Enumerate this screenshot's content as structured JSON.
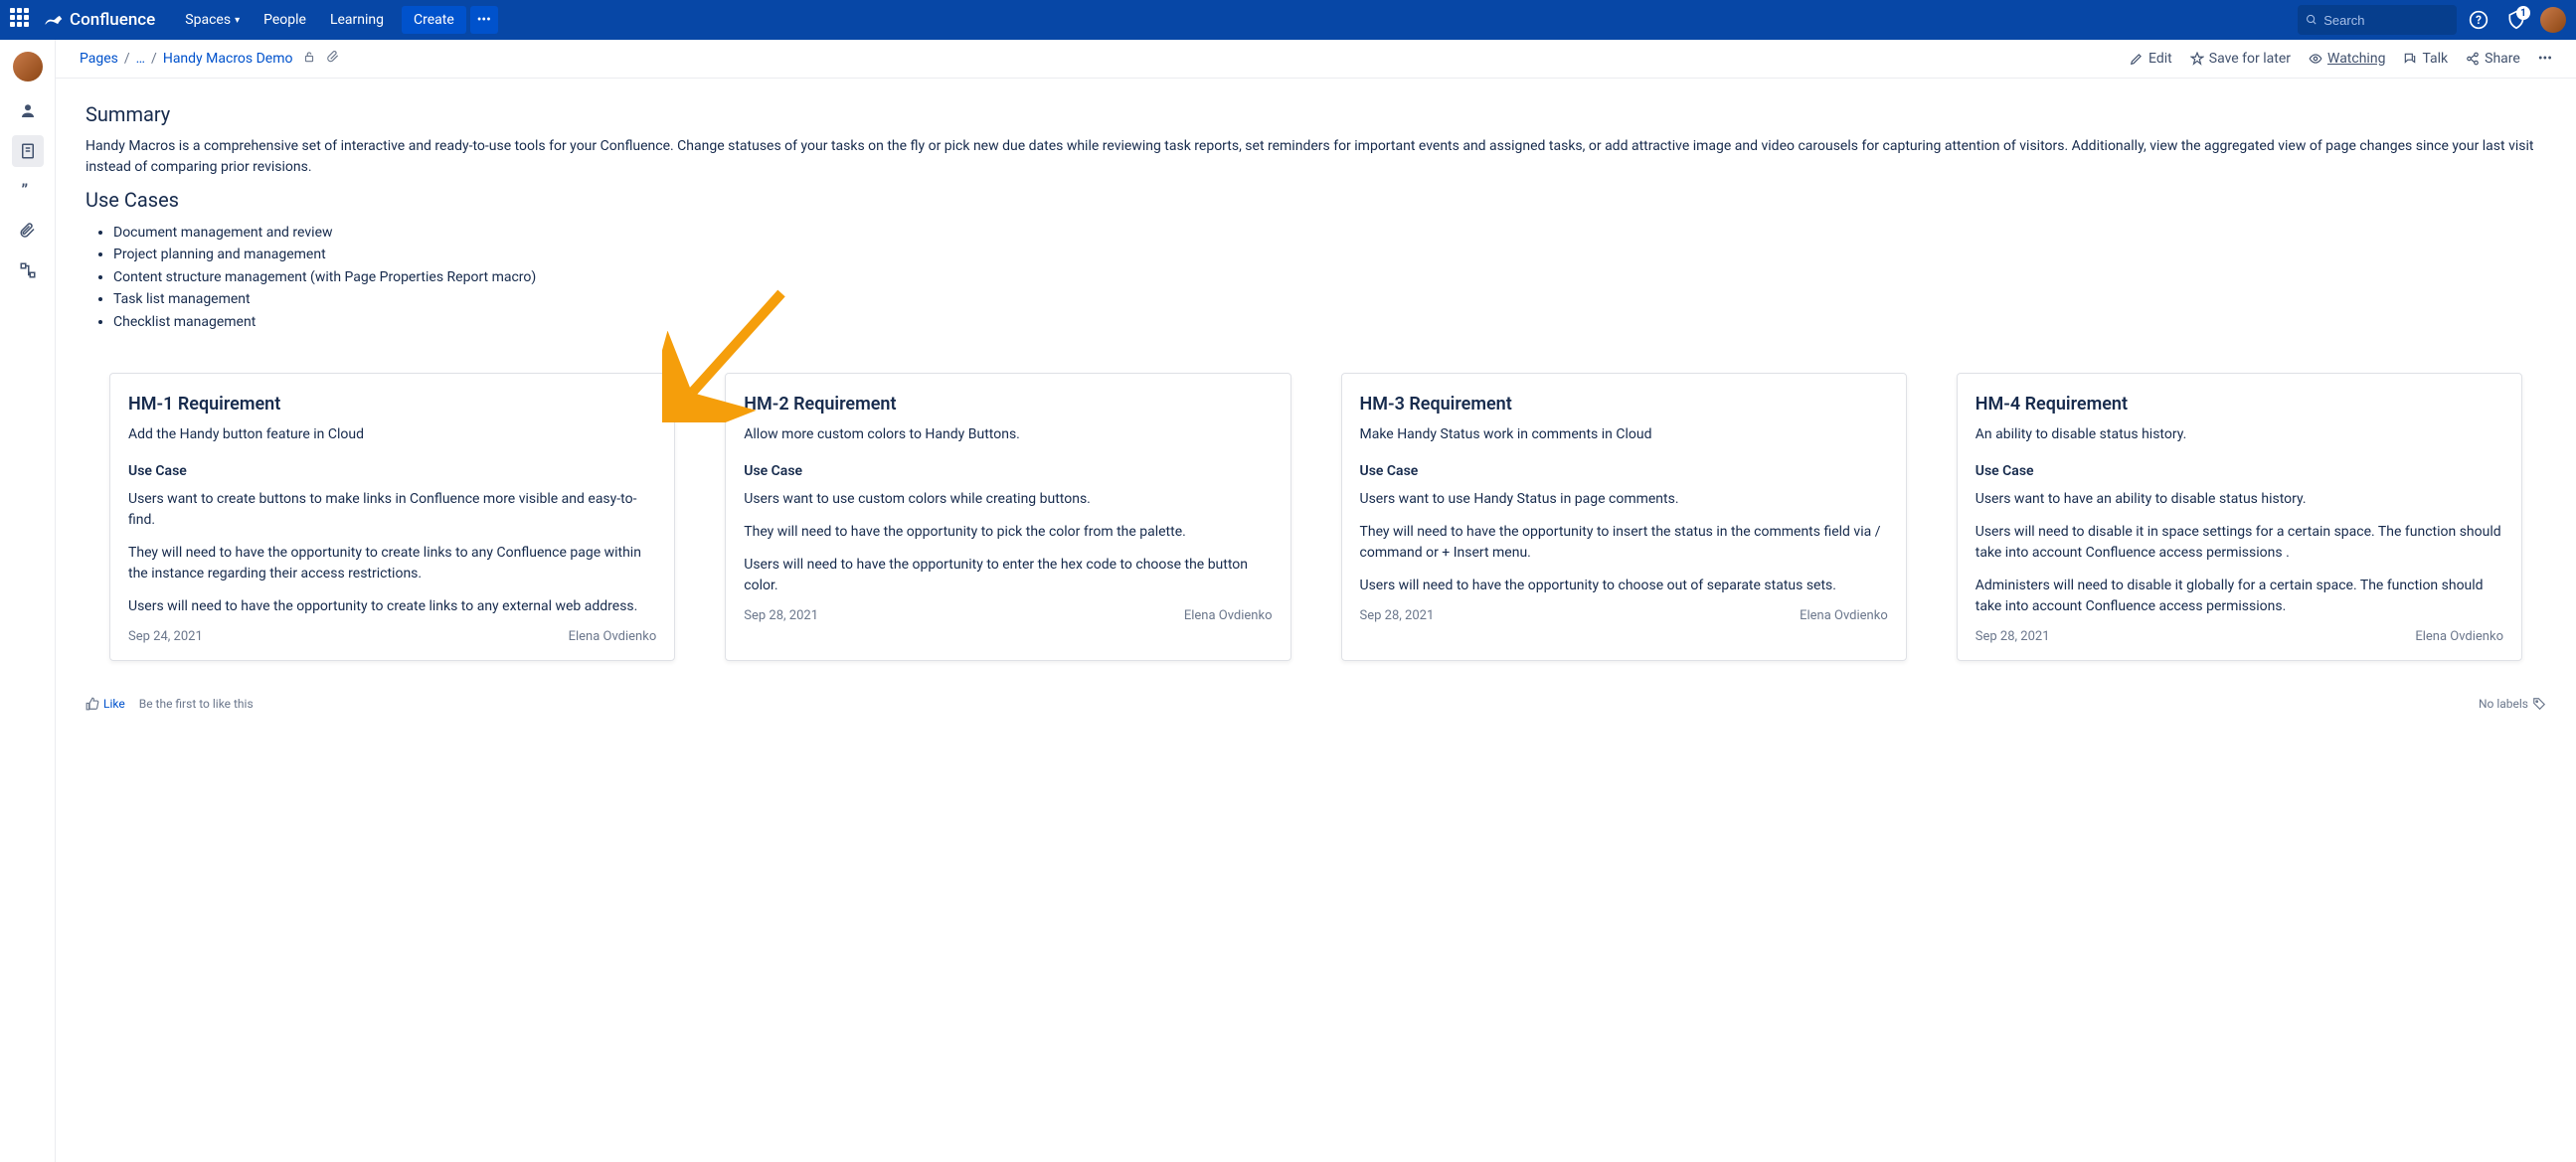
{
  "header": {
    "logo": "Confluence",
    "nav": {
      "spaces": "Spaces",
      "people": "People",
      "learning": "Learning"
    },
    "create": "Create",
    "search_placeholder": "Search",
    "notification_count": "1"
  },
  "breadcrumbs": {
    "pages": "Pages",
    "ellipsis": "…",
    "current": "Handy Macros Demo"
  },
  "actions": {
    "edit": "Edit",
    "save": "Save for later",
    "watching": "Watching",
    "talk": "Talk",
    "share": "Share"
  },
  "summary": {
    "heading": "Summary",
    "text": "Handy Macros is a comprehensive set of interactive and ready-to-use tools for your Confluence. Change statuses of your tasks on the fly or pick new due dates while reviewing task reports, set reminders for important events and assigned tasks, or add attractive image and video carousels for capturing attention of visitors. Additionally, view the aggregated view of page changes since your last visit instead of comparing prior revisions."
  },
  "usecases": {
    "heading": "Use Cases",
    "items": [
      "Document management and review",
      "Project planning and management",
      "Content structure management (with Page Properties Report macro)",
      "Task list management",
      "Checklist management"
    ]
  },
  "cards": [
    {
      "title": "HM-1 Requirement",
      "subtitle": "Add the Handy button feature in Cloud",
      "ucHead": "Use Case",
      "p1": "Users want to create buttons to make links in Confluence more visible and easy-to-find.",
      "p2": "They will need to have the opportunity to create links to any Confluence page within the instance regarding their access restrictions.",
      "p3": "Users will need to have the opportunity to create links to any external web address.",
      "date": "Sep 24, 2021",
      "author": "Elena Ovdienko"
    },
    {
      "title": "HM-2 Requirement",
      "subtitle": "Allow more custom colors to Handy Buttons.",
      "ucHead": "Use Case",
      "p1": "Users want to use custom colors while creating buttons.",
      "p2": "They will need to have the opportunity to pick the color from the palette.",
      "p3": "Users will need to have the opportunity to enter the hex code to choose the button color.",
      "date": "Sep 28, 2021",
      "author": "Elena Ovdienko"
    },
    {
      "title": "HM-3 Requirement",
      "subtitle": "Make Handy Status work in comments in Cloud",
      "ucHead": "Use Case",
      "p1": "Users want to use Handy Status in page comments.",
      "p2": "They will need to have the opportunity to insert the status in the comments field via / command or + Insert menu.",
      "p3": "Users will need to have the opportunity to choose out of separate status sets.",
      "date": "Sep 28, 2021",
      "author": "Elena Ovdienko"
    },
    {
      "title": "HM-4 Requirement",
      "subtitle": "An ability to disable status history.",
      "ucHead": "Use Case",
      "p1": "Users want to have an ability to disable status history.",
      "p2": "Users will need to disable it in space settings for a certain space. The function should take into account Confluence access permissions .",
      "p3": "Administers will need to disable it globally for a certain space. The function should take into account Confluence access permissions.",
      "date": "Sep 28, 2021",
      "author": "Elena Ovdienko"
    }
  ],
  "footer": {
    "like": "Like",
    "likeMsg": "Be the first to like this",
    "labels": "No labels"
  }
}
